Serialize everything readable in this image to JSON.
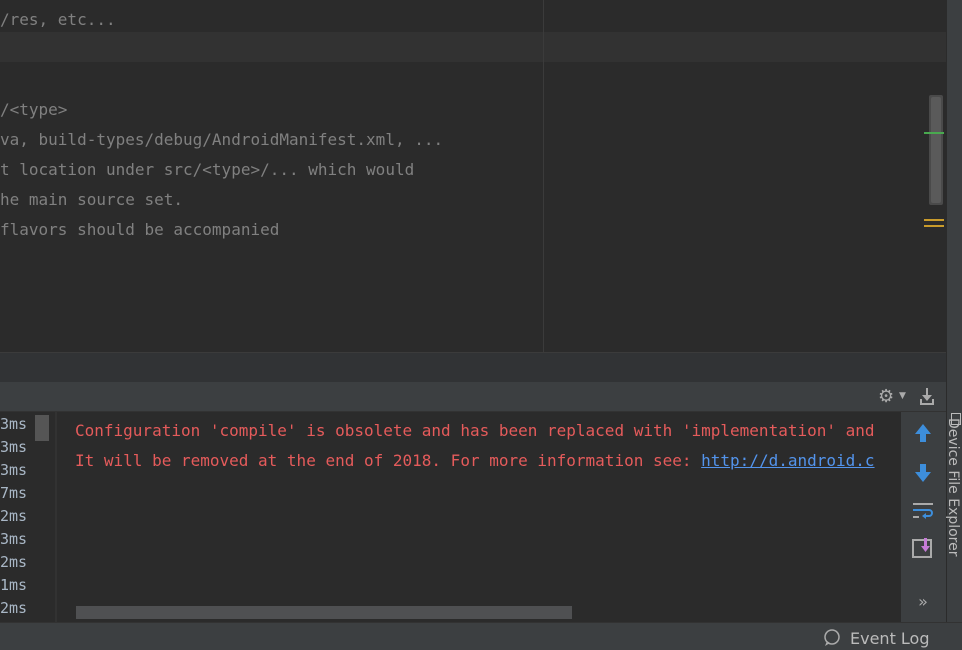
{
  "editor": {
    "lines": [
      "/res, etc...",
      "/<type>",
      "va, build-types/debug/AndroidManifest.xml, ...",
      "t location under src/<type>/... which would",
      "he main source set.",
      "flavors should be accompanied"
    ]
  },
  "build_panel": {
    "timings": [
      "3ms",
      "3ms",
      "3ms",
      "7ms",
      "2ms",
      "3ms",
      "2ms",
      "1ms",
      "2ms"
    ],
    "console": {
      "line1": "Configuration 'compile' is obsolete and has been replaced with 'implementation' and",
      "line2_prefix": "It will be removed at the end of 2018. For more information see: ",
      "line2_link": "http://d.android.c"
    },
    "toolbar": {
      "more_label": "»"
    }
  },
  "right_strip": {
    "label": "Device File Explorer"
  },
  "status_bar": {
    "event_log_label": "Event Log"
  },
  "colors": {
    "error_text": "#e55b5b",
    "link": "#5394ec",
    "toolbar_arrow": "#3d8edb",
    "editor_bg": "#2b2b2b",
    "panel_bg": "#3c3f41"
  }
}
